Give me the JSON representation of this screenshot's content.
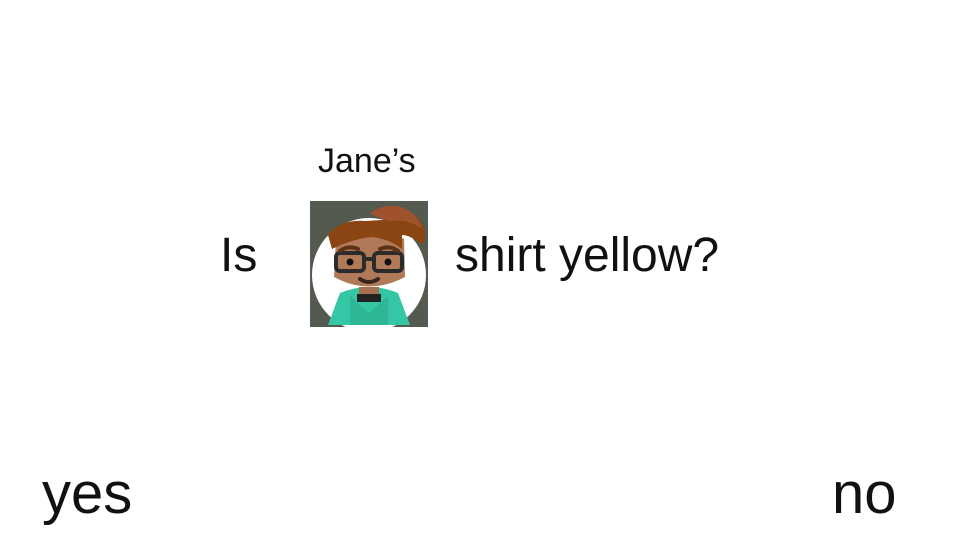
{
  "question": {
    "owner_label": "Jane’s",
    "prefix": "Is",
    "suffix": "shirt yellow?"
  },
  "avatar": {
    "icon": "cartoon-boy-avatar-icon",
    "colors": {
      "background": "#545a50",
      "circle": "#ffffff",
      "hair": "#8b4513",
      "skin": "#b07a58",
      "glasses": "#2b2b2b",
      "shirt": "#35c7a5"
    }
  },
  "answers": {
    "yes_label": "yes",
    "no_label": "no"
  }
}
